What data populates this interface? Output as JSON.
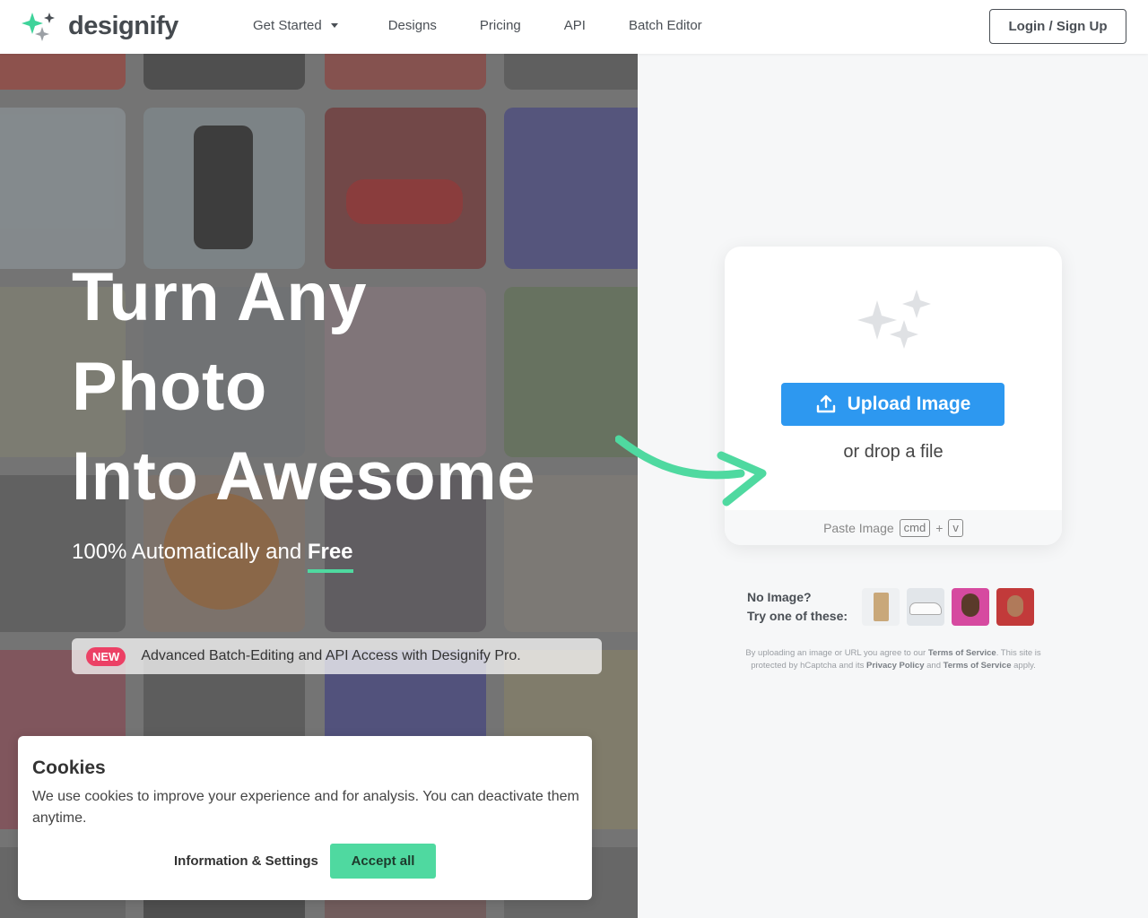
{
  "header": {
    "logo_text": "designify",
    "nav": [
      "Get Started",
      "Designs",
      "Pricing",
      "API",
      "Batch Editor"
    ],
    "login_label": "Login / Sign Up"
  },
  "hero": {
    "title_line1": "Turn Any",
    "title_line2": "Photo",
    "title_line3": "Into Awesome",
    "subtitle_prefix": "100% Automatically and ",
    "subtitle_highlight": "Free",
    "new_badge": "NEW",
    "new_text": "Advanced Batch-Editing and API Access with Designify Pro."
  },
  "upload": {
    "button_label": "Upload Image",
    "drop_text": "or drop a file",
    "paste_label": "Paste Image",
    "key_cmd": "cmd",
    "key_plus": "+",
    "key_v": "v"
  },
  "samples": {
    "label_line1": "No Image?",
    "label_line2": "Try one of these:"
  },
  "terms": {
    "t1": "By uploading an image or URL you agree to our ",
    "tos1": "Terms of Service",
    "t2": ". This site is protected by hCaptcha and its ",
    "privacy": "Privacy Policy",
    "t3": " and ",
    "tos2": "Terms of Service",
    "t4": " apply."
  },
  "cookie": {
    "title": "Cookies",
    "text": "We use cookies to improve your experience and for analysis. You can deactivate them anytime.",
    "info_label": "Information & Settings",
    "accept_label": "Accept all"
  },
  "colors": {
    "accent_green": "#4fd9a0",
    "upload_blue": "#2d98f0",
    "badge_red": "#ec4065"
  }
}
